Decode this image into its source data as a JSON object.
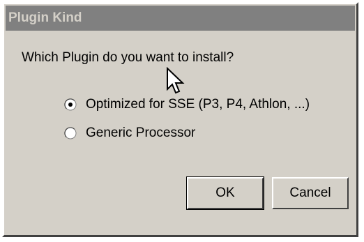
{
  "dialog": {
    "title": "Plugin Kind",
    "question": "Which Plugin do you want to install?",
    "options": [
      {
        "label": "Optimized for SSE (P3, P4, Athlon, ...)",
        "selected": true
      },
      {
        "label": "Generic Processor",
        "selected": false
      }
    ],
    "ok_label": "OK",
    "cancel_label": "Cancel"
  },
  "colors": {
    "face": "#d4d0c8",
    "titlebar_inactive": "#808080",
    "titlebar_text": "#d4d0c8"
  },
  "icons": {
    "cursor": "arrow-cursor-icon",
    "radio": "radio-button-icon"
  }
}
